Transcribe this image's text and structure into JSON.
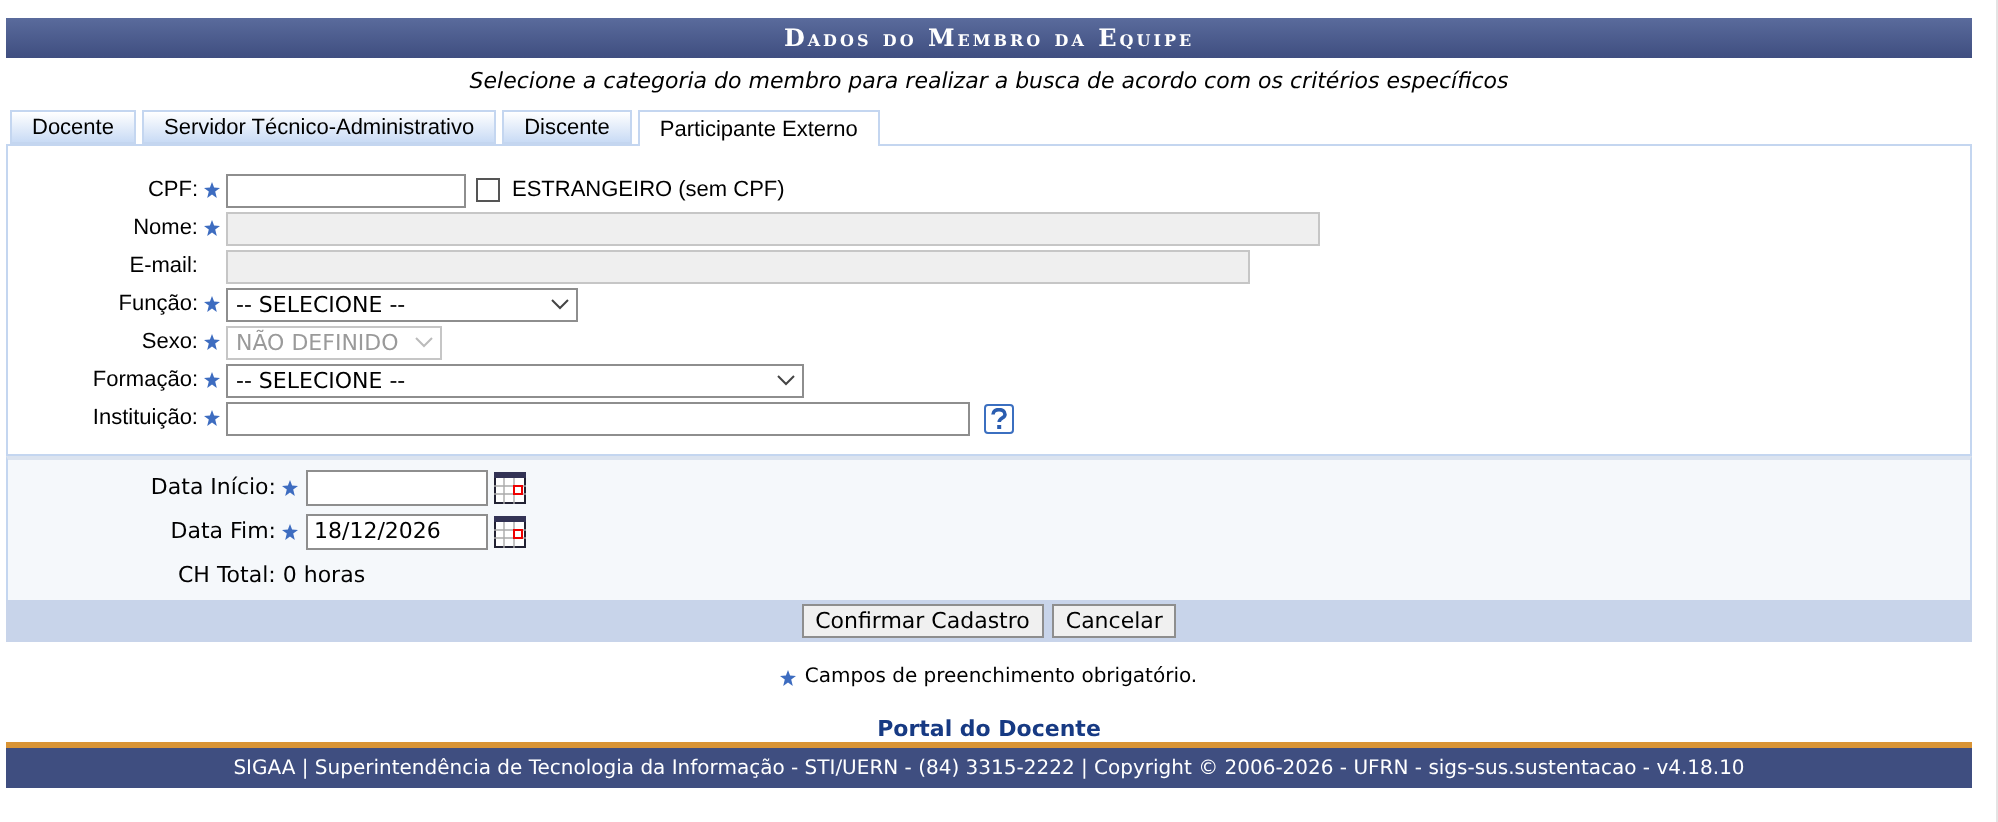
{
  "section_title": "Dados do Membro da Equipe",
  "instruction": "Selecione a categoria do membro para realizar a busca de acordo com os critérios específicos",
  "tabs": [
    {
      "label": "Docente",
      "selected": false
    },
    {
      "label": "Servidor Técnico-Administrativo",
      "selected": false
    },
    {
      "label": "Discente",
      "selected": false
    },
    {
      "label": "Participante Externo",
      "selected": true
    }
  ],
  "fields": [
    {
      "kind": "text",
      "label": "CPF:",
      "required": true,
      "disabled": false,
      "checkbox": {
        "label": "ESTRANGEIRO (sem CPF)",
        "checked": false
      }
    },
    {
      "kind": "text",
      "label": "Nome:",
      "required": true,
      "disabled": true
    },
    {
      "kind": "text",
      "label": "E-mail:",
      "required": false,
      "disabled": true
    },
    {
      "kind": "select",
      "label": "Função:",
      "required": true,
      "disabled": false,
      "value": "-- SELECIONE --"
    },
    {
      "kind": "select",
      "label": "Sexo:",
      "required": true,
      "disabled": true,
      "value": "NÃO DEFINIDO"
    },
    {
      "kind": "select",
      "label": "Formação:",
      "required": true,
      "disabled": false,
      "value": "-- SELECIONE --"
    },
    {
      "kind": "text",
      "label": "Instituição:",
      "required": true,
      "disabled": false,
      "help": true
    }
  ],
  "dates": [
    {
      "kind": "date",
      "label": "Data Início:",
      "required": true
    },
    {
      "kind": "date",
      "label": "Data Fim:",
      "required": true,
      "value": "18/12/2026"
    },
    {
      "kind": "total",
      "label": "CH Total:",
      "value": "0 horas"
    }
  ],
  "buttons": [
    "Confirmar Cadastro",
    "Cancelar"
  ],
  "required_note": "Campos de preenchimento obrigatório.",
  "portal_link": "Portal do Docente",
  "footer": "SIGAA | Superintendência de Tecnologia da Informação - STI/UERN - (84) 3315-2222 | Copyright © 2006-2026 - UFRN - sigs-sus.sustentacao - v4.18.10"
}
